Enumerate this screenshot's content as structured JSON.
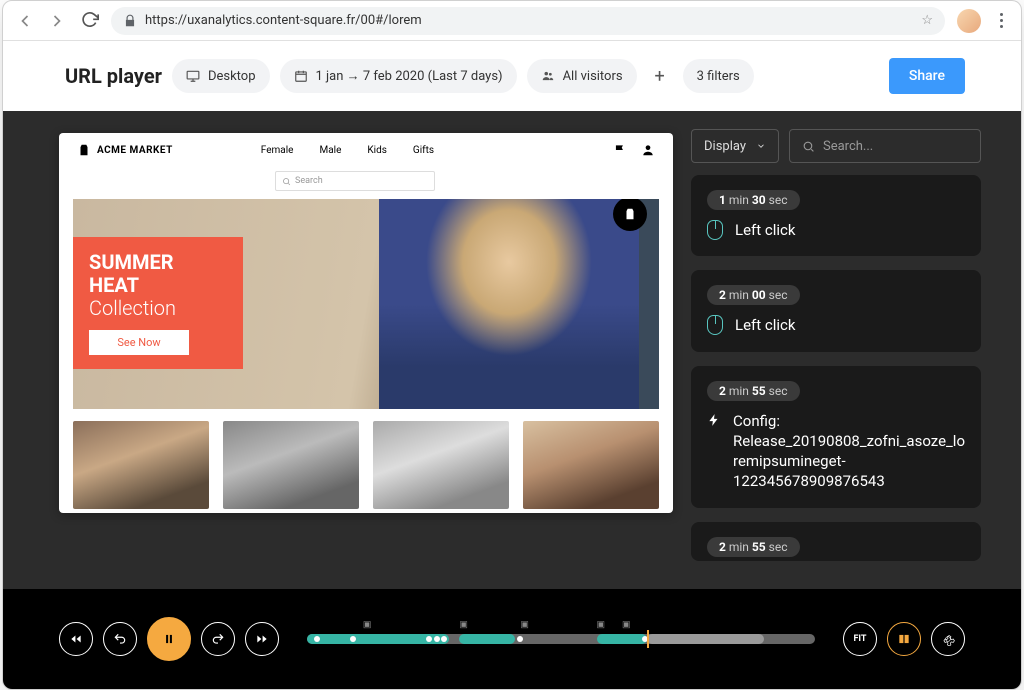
{
  "browser": {
    "url": "https://uxanalytics.content-square.fr/00#/lorem"
  },
  "toolbar": {
    "title": "URL player",
    "device": "Desktop",
    "date_range": "1 jan → 7 feb 2020 (Last 7 days)",
    "audience": "All visitors",
    "filters": "3 filters",
    "share": "Share"
  },
  "site": {
    "brand": "ACME MARKET",
    "nav": [
      "Female",
      "Male",
      "Kids",
      "Gifts"
    ],
    "search_placeholder": "Search",
    "promo_line1": "SUMMER",
    "promo_line2": "HEAT",
    "promo_line3": "Collection",
    "promo_cta": "See Now"
  },
  "events_panel": {
    "display_label": "Display",
    "search_placeholder": "Search...",
    "events": [
      {
        "min": "1",
        "sec": "30",
        "type": "click",
        "label": "Left click"
      },
      {
        "min": "2",
        "sec": "00",
        "type": "click",
        "label": "Left click"
      },
      {
        "min": "2",
        "sec": "55",
        "type": "config",
        "label": "Config: Release_20190808_zofni_asoze_loremipsumineget-122345678909876543"
      },
      {
        "min": "2",
        "sec": "55",
        "type": "click",
        "label": ""
      }
    ]
  },
  "player": {
    "fit_label": "FIT"
  }
}
